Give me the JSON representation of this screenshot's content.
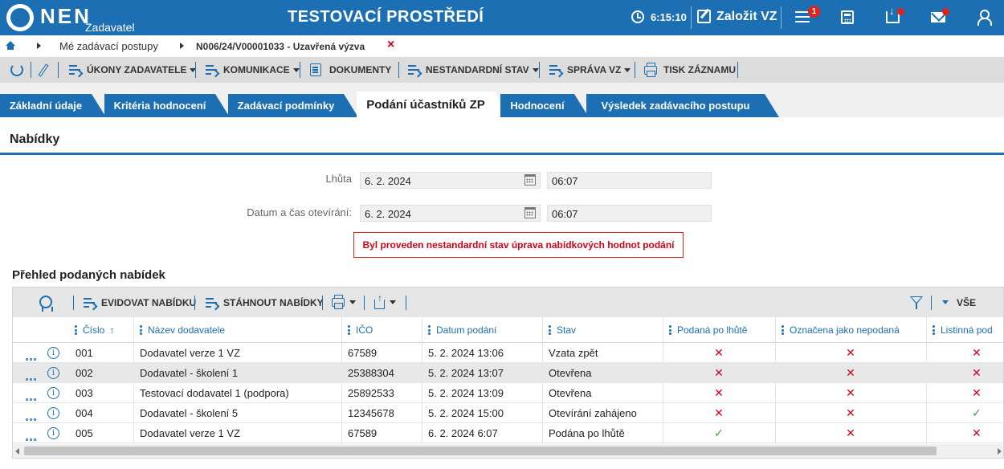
{
  "header": {
    "logo_text": "NEN",
    "logo_sub": "Zadavatel",
    "env_title": "TESTOVACÍ PROSTŘEDÍ",
    "time": "6:15:10",
    "new_vz_label": "Založit VZ",
    "notification_count": "1"
  },
  "breadcrumb": {
    "items": [
      "Mé zadávací postupy",
      "N006/24/V00001033 - Uzavřená výzva"
    ],
    "close_symbol": "×"
  },
  "toolbar": {
    "ukony": "ÚKONY ZADAVATELE",
    "komunikace": "KOMUNIKACE",
    "dokumenty": "DOKUMENTY",
    "nestandardni": "NESTANDARDNÍ STAV",
    "sprava": "SPRÁVA VZ",
    "tisk": "TISK ZÁZNAMU"
  },
  "tabs": [
    {
      "label": "Základní údaje"
    },
    {
      "label": "Kritéria hodnocení"
    },
    {
      "label": "Zadávací podmínky"
    },
    {
      "label": "Podání účastníků ZP",
      "active": true
    },
    {
      "label": "Hodnocení"
    },
    {
      "label": "Výsledek zadávacího postupu"
    }
  ],
  "section": {
    "title": "Nabídky"
  },
  "form": {
    "lhuta_label": "Lhůta",
    "lhuta_date": "6. 2. 2024",
    "lhuta_time": "06:07",
    "otevirani_label": "Datum a čas otevírání:",
    "otevirani_date": "6. 2. 2024",
    "otevirani_time": "06:07"
  },
  "alert": {
    "text": "Byl proveden nestandardní stav úprava nabídkových hodnot podání"
  },
  "grid": {
    "title": "Přehled podaných nabídek",
    "toolbar": {
      "evidovat": "EVIDOVAT NABÍDKU",
      "stahnout": "STÁHNOUT NABÍDKY",
      "vse": "VŠE"
    },
    "columns": {
      "cislo": "Číslo",
      "nazev": "Název dodavatele",
      "ico": "IČO",
      "datum": "Datum podání",
      "stav": "Stav",
      "podana": "Podaná po lhůtě",
      "oznacena": "Označena jako nepodaná",
      "listinna": "Listinná pod"
    },
    "sort_symbol": "↑",
    "rows": [
      {
        "cislo": "001",
        "nazev": "Dodavatel verze 1 VZ",
        "ico": "67589",
        "datum": "5. 2. 2024 13:06",
        "stav": "Vzata zpět",
        "podana": "✕",
        "oznacena": "✕",
        "listinna": "✕"
      },
      {
        "cislo": "002",
        "nazev": "Dodavatel - školení 1",
        "ico": "25388304",
        "datum": "5. 2. 2024 13:07",
        "stav": "Otevřena",
        "podana": "✕",
        "oznacena": "✕",
        "listinna": "✕"
      },
      {
        "cislo": "003",
        "nazev": "Testovací dodavatel 1 (podpora)",
        "ico": "25892533",
        "datum": "5. 2. 2024 13:09",
        "stav": "Otevřena",
        "podana": "✕",
        "oznacena": "✕",
        "listinna": "✕"
      },
      {
        "cislo": "004",
        "nazev": "Dodavatel - školení 5",
        "ico": "12345678",
        "datum": "5. 2. 2024 15:00",
        "stav": "Otevírání zahájeno",
        "podana": "✕",
        "oznacena": "✕",
        "listinna": "✓"
      },
      {
        "cislo": "005",
        "nazev": "Dodavatel verze 1 VZ",
        "ico": "67589",
        "datum": "6. 2. 2024 6:07",
        "stav": "Podána po lhůtě",
        "podana": "✓",
        "oznacena": "✕",
        "listinna": "✕"
      }
    ]
  },
  "colors": {
    "brand_blue": "#1b6fb2",
    "alert_red": "#d0021b",
    "ok_green": "#3a9d3a"
  }
}
